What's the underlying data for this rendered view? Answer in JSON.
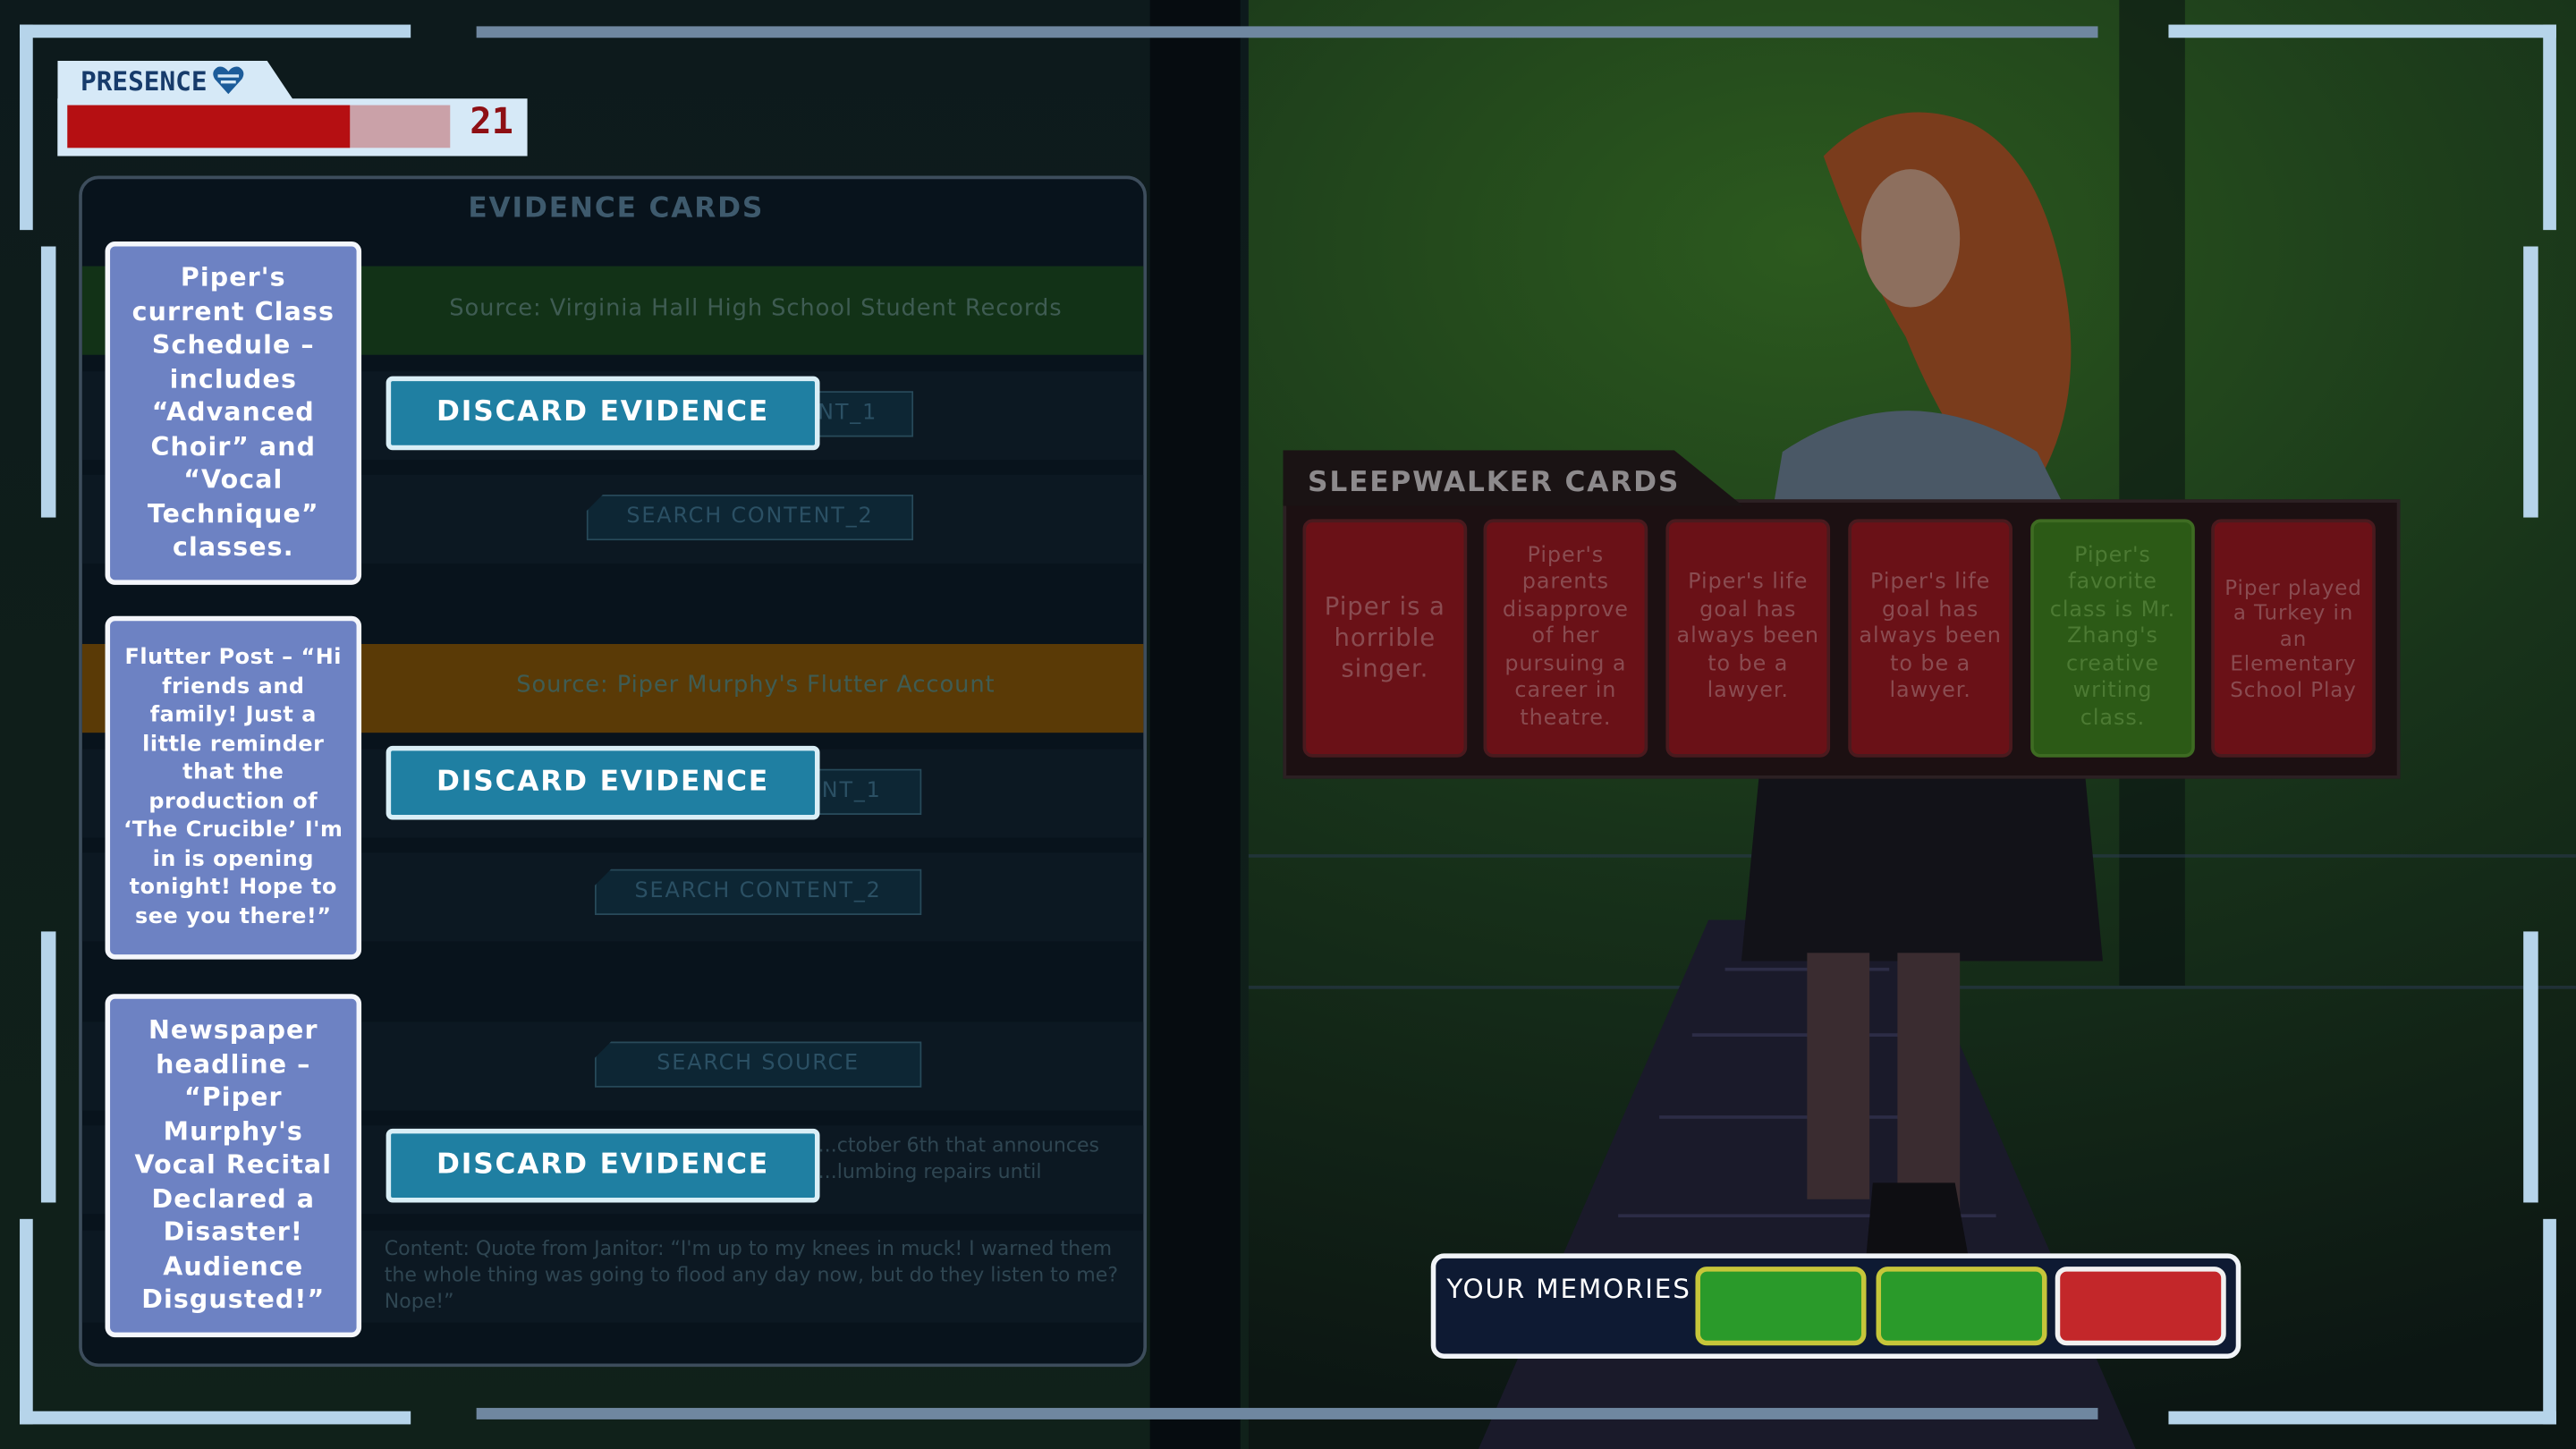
{
  "presence": {
    "label": "PRESENCE",
    "value": "21",
    "level": 0.74,
    "heart_icon": "heart-icon"
  },
  "evidence": {
    "title": "EVIDENCE CARDS",
    "sources": [
      {
        "source": "Source: Virginia Hall High School Student Records",
        "btn1": "SEARCH CONTENT_1",
        "btn2": "SEARCH CONTENT_2",
        "color": "#123217"
      },
      {
        "source": "Source: Piper Murphy's Flutter Account",
        "btn1": "SEARCH CONTENT_1",
        "btn2": "SEARCH CONTENT_2",
        "color": "#5a3a06"
      },
      {
        "source_btn": "SEARCH SOURCE",
        "content_a": "...ctober 6th that announces ...lumbing repairs until",
        "content_b": "Content: Quote from Janitor: “I'm up to my knees in muck! I warned them the whole thing was going to flood any day now, but do they listen to me? Nope!”"
      }
    ],
    "cards": [
      {
        "text": "Piper's current Class Schedule – includes “Advanced Choir” and “Vocal Technique” classes.",
        "discard": "DISCARD EVIDENCE"
      },
      {
        "text": "Flutter Post – “Hi friends and family! Just a little reminder that the production of ‘The Crucible’ I'm in is opening tonight! Hope to see you there!”",
        "discard": "DISCARD EVIDENCE"
      },
      {
        "text": "Newspaper headline – “Piper Murphy's Vocal Recital Declared a Disaster! Audience Disgusted!”",
        "discard": "DISCARD EVIDENCE"
      }
    ]
  },
  "sleepwalker": {
    "title": "SLEEPWALKER CARDS",
    "cards": [
      {
        "text": "Piper is a horrible singer.",
        "state": "red"
      },
      {
        "text": "Piper's parents disapprove of her pursuing a career in theatre.",
        "state": "red"
      },
      {
        "text": "Piper's life goal has always been to be a lawyer.",
        "state": "red"
      },
      {
        "text": "Piper's life goal has always been to be a lawyer.",
        "state": "red"
      },
      {
        "text": "Piper's favorite class is Mr. Zhang's creative writing class.",
        "state": "green"
      },
      {
        "text": "Piper played a Turkey in an Elementary School Play",
        "state": "red"
      }
    ]
  },
  "memories": {
    "label": "YOUR MEMORIES",
    "slots": [
      {
        "state": "green",
        "color": "#2a9a2a"
      },
      {
        "state": "green",
        "color": "#2a9a2a"
      },
      {
        "state": "red",
        "color": "#c3272a"
      }
    ]
  }
}
